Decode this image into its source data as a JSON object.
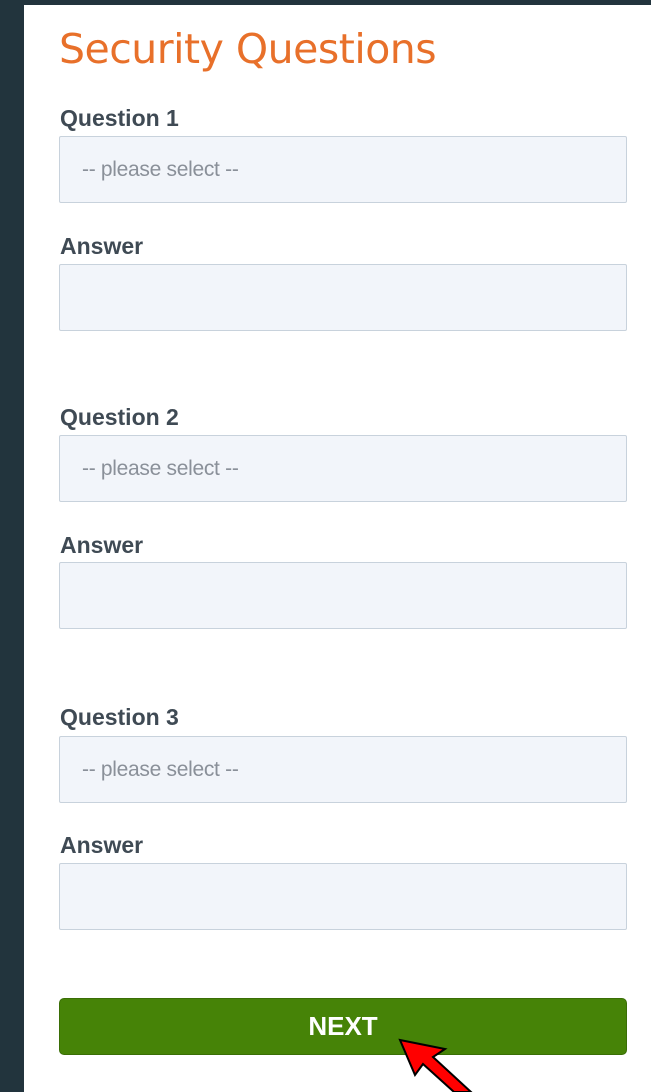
{
  "form": {
    "title": "Security Questions",
    "questions": [
      {
        "label": "Question 1",
        "select_value": "-- please select --",
        "answer_label": "Answer",
        "answer_value": ""
      },
      {
        "label": "Question 2",
        "select_value": "-- please select --",
        "answer_label": "Answer",
        "answer_value": ""
      },
      {
        "label": "Question 3",
        "select_value": "-- please select --",
        "answer_label": "Answer",
        "answer_value": ""
      }
    ],
    "next_label": "NEXT"
  },
  "colors": {
    "title": "#e8702a",
    "button": "#468307",
    "background": "#22343d",
    "field_bg": "#f2f5fa",
    "arrow": "#ff0000"
  },
  "annotation": {
    "icon": "red-arrow-icon"
  }
}
